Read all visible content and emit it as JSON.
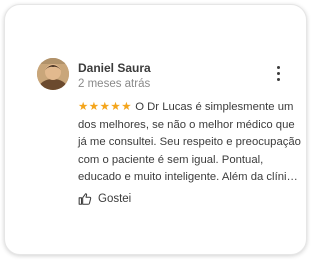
{
  "review": {
    "author": "Daniel Saura",
    "time_ago": "2 meses atrás",
    "rating": 5,
    "stars_text": "★★★★★",
    "text_lines": [
      "O Dr Lucas é simplesmente um",
      "dos melhores, se não o melhor médico que",
      "já me consultei. Seu respeito e preocupação",
      "com o paciente é sem igual. Pontual,",
      "educado e muito inteligente. Além da clíni…"
    ],
    "star_color": "#F4A51C",
    "like_label": "Gostei",
    "icons": {
      "avatar": "avatar-photo",
      "more": "more-vert-icon",
      "like": "thumb-up-icon"
    }
  }
}
